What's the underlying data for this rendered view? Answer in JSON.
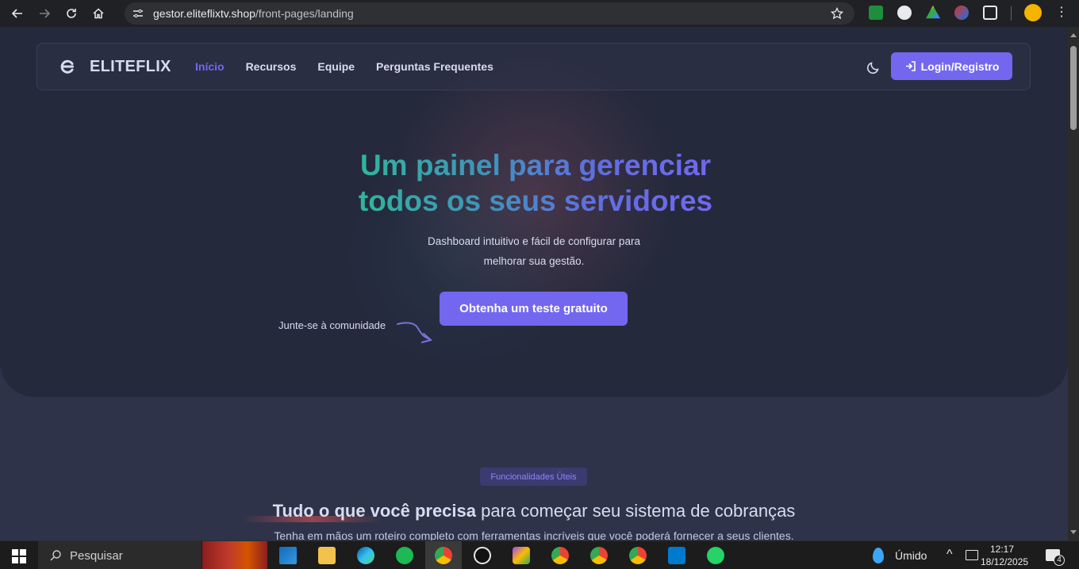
{
  "browser": {
    "url_host": "gestor.eliteflixtv.shop",
    "url_path": "/front-pages/landing"
  },
  "navbar": {
    "brand": "ELITEFLIX",
    "menu": [
      {
        "label": "Início",
        "active": true
      },
      {
        "label": "Recursos",
        "active": false
      },
      {
        "label": "Equipe",
        "active": false
      },
      {
        "label": "Perguntas Frequentes",
        "active": false
      }
    ],
    "login_label": "Login/Registro"
  },
  "hero": {
    "headline_line1": "Um painel para gerenciar",
    "headline_line2": "todos os seus servidores",
    "subtitle_line1": "Dashboard intuitivo e fácil de configurar para",
    "subtitle_line2": "melhorar sua gestão.",
    "cta_label": "Obtenha um teste gratuito",
    "join_text": "Junte-se à comunidade"
  },
  "features": {
    "badge": "Funcionalidades Úteis",
    "title_bold": "Tudo o que você precisa",
    "title_rest": " para começar seu sistema de cobranças",
    "subtitle": "Tenha em mãos um roteiro completo com ferramentas incríveis que você poderá fornecer a seus clientes."
  },
  "taskbar": {
    "search_placeholder": "Pesquisar",
    "weather": "Úmido",
    "time": "12:17",
    "date": "18/12/2025",
    "notifications": "4"
  },
  "colors": {
    "accent": "#7367f0",
    "hero_bg": "#25293c",
    "page_bg": "#2f3349"
  }
}
